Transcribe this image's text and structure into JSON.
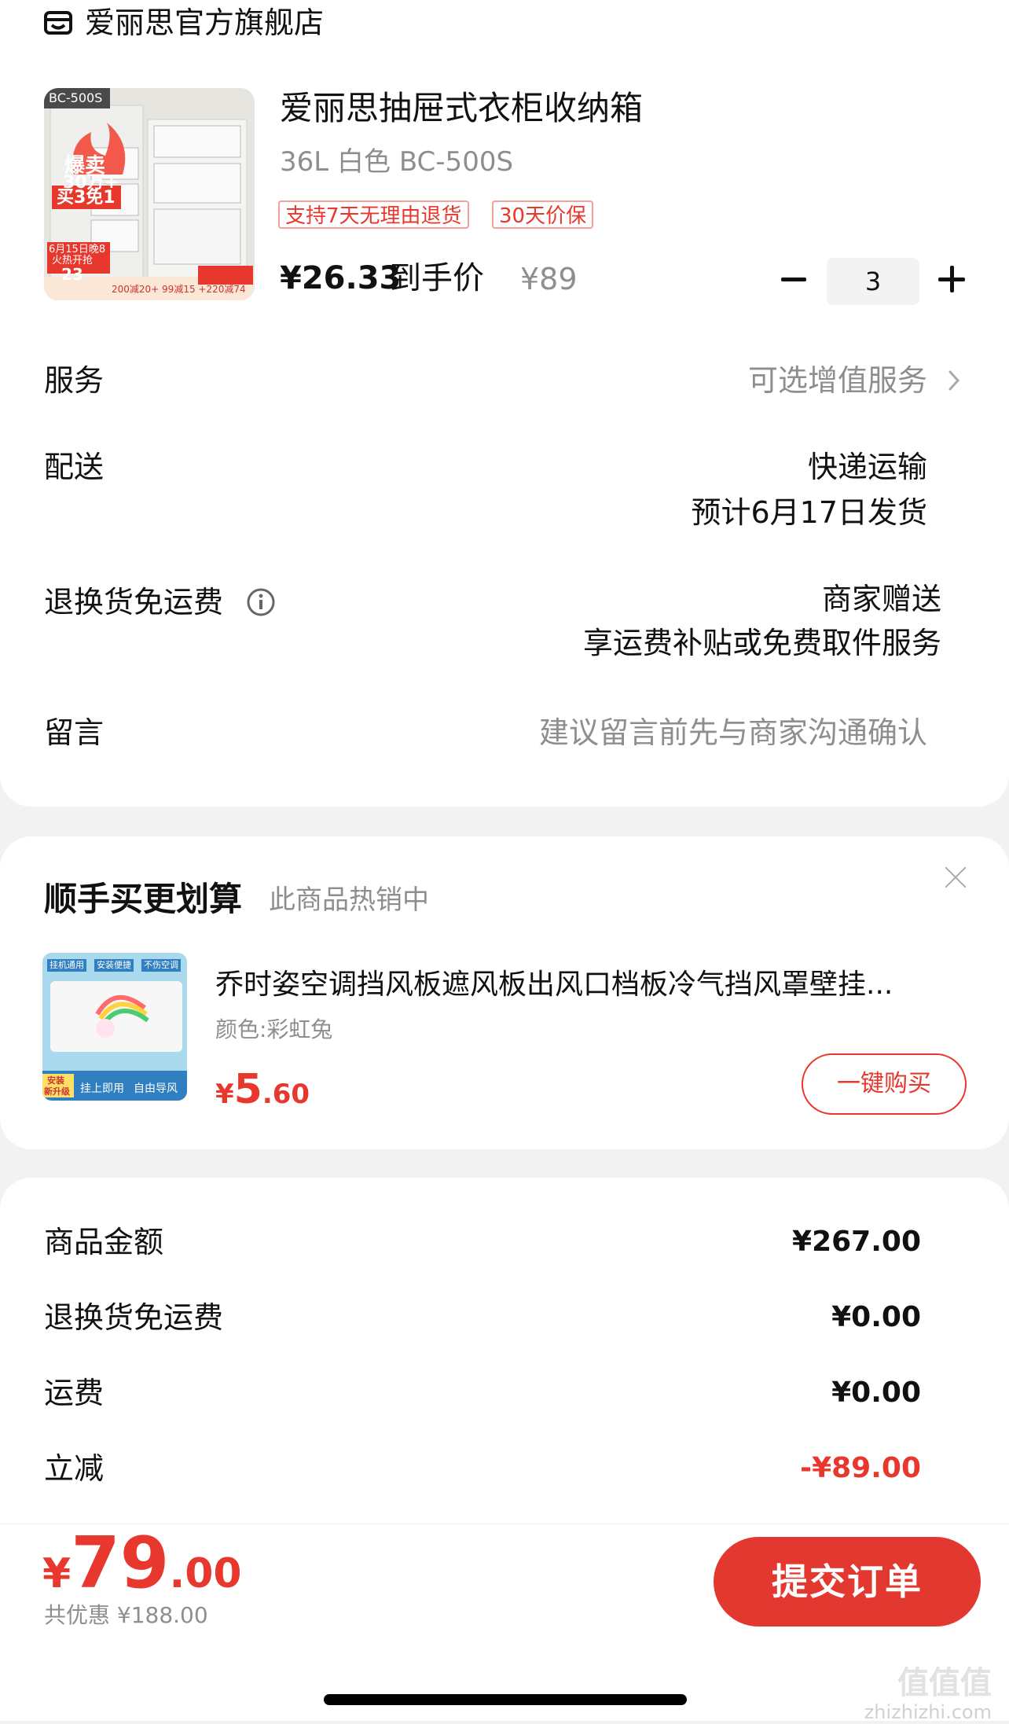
{
  "store": {
    "name": "爱丽思官方旗舰店"
  },
  "product": {
    "title": "爱丽思抽屉式衣柜收纳箱",
    "spec": "36L 白色 BC-500S",
    "tags": [
      "支持7天无理由退货",
      "30天价保"
    ],
    "price": "¥26.33",
    "price_suffix": "到手价",
    "original_price": "¥89",
    "quantity": "3",
    "image_text": {
      "model": "BC-500S",
      "hot1": "爆卖",
      "hot2": "30万+",
      "hot3": "买3免1",
      "event1": "6月15日晚8",
      "event2": "火热开抢",
      "price": "23",
      "coupons": "200减20+ 99减15 +220减74"
    }
  },
  "rows": {
    "service": {
      "label": "服务",
      "value": "可选增值服务"
    },
    "delivery": {
      "label": "配送",
      "value1": "快递运输",
      "value2": "预计6月17日发货"
    },
    "returns": {
      "label": "退换货免运费",
      "value1": "商家赠送",
      "value2": "享运费补贴或免费取件服务"
    },
    "message": {
      "label": "留言",
      "placeholder": "建议留言前先与商家沟通确认"
    }
  },
  "recommend": {
    "title": "顺手买更划算",
    "subtitle": "此商品热销中",
    "item": {
      "name": "乔时姿空调挡风板遮风板出风口档板冷气挡风罩壁挂...",
      "spec": "颜色:彩虹兔",
      "price_currency": "¥",
      "price_int": "5",
      "price_dec": ".60",
      "buy_label": "一键购买",
      "image_text": {
        "tag1": "挂机通用",
        "tag2": "安装便捷",
        "tag3": "不伤空调",
        "bottom1": "安装",
        "bottom2": "新升级",
        "bottom3": "挂上即用",
        "bottom4": "自由导风"
      }
    }
  },
  "summary": [
    {
      "label": "商品金额",
      "value": "¥267.00",
      "negative": false
    },
    {
      "label": "退换货免运费",
      "value": "¥0.00",
      "negative": false
    },
    {
      "label": "运费",
      "value": "¥0.00",
      "negative": false
    },
    {
      "label": "立减",
      "value": "-¥89.00",
      "negative": true
    }
  ],
  "footer": {
    "total_currency": "¥",
    "total_int": "79",
    "total_dec": ".00",
    "saving": "共优惠 ¥188.00",
    "submit_label": "提交订单",
    "watermark1": "值值值",
    "watermark2": "zhizhizhi.com"
  },
  "colors": {
    "accent": "#e2382f",
    "price_red": "#e8372d",
    "muted": "#8e8e8e"
  }
}
